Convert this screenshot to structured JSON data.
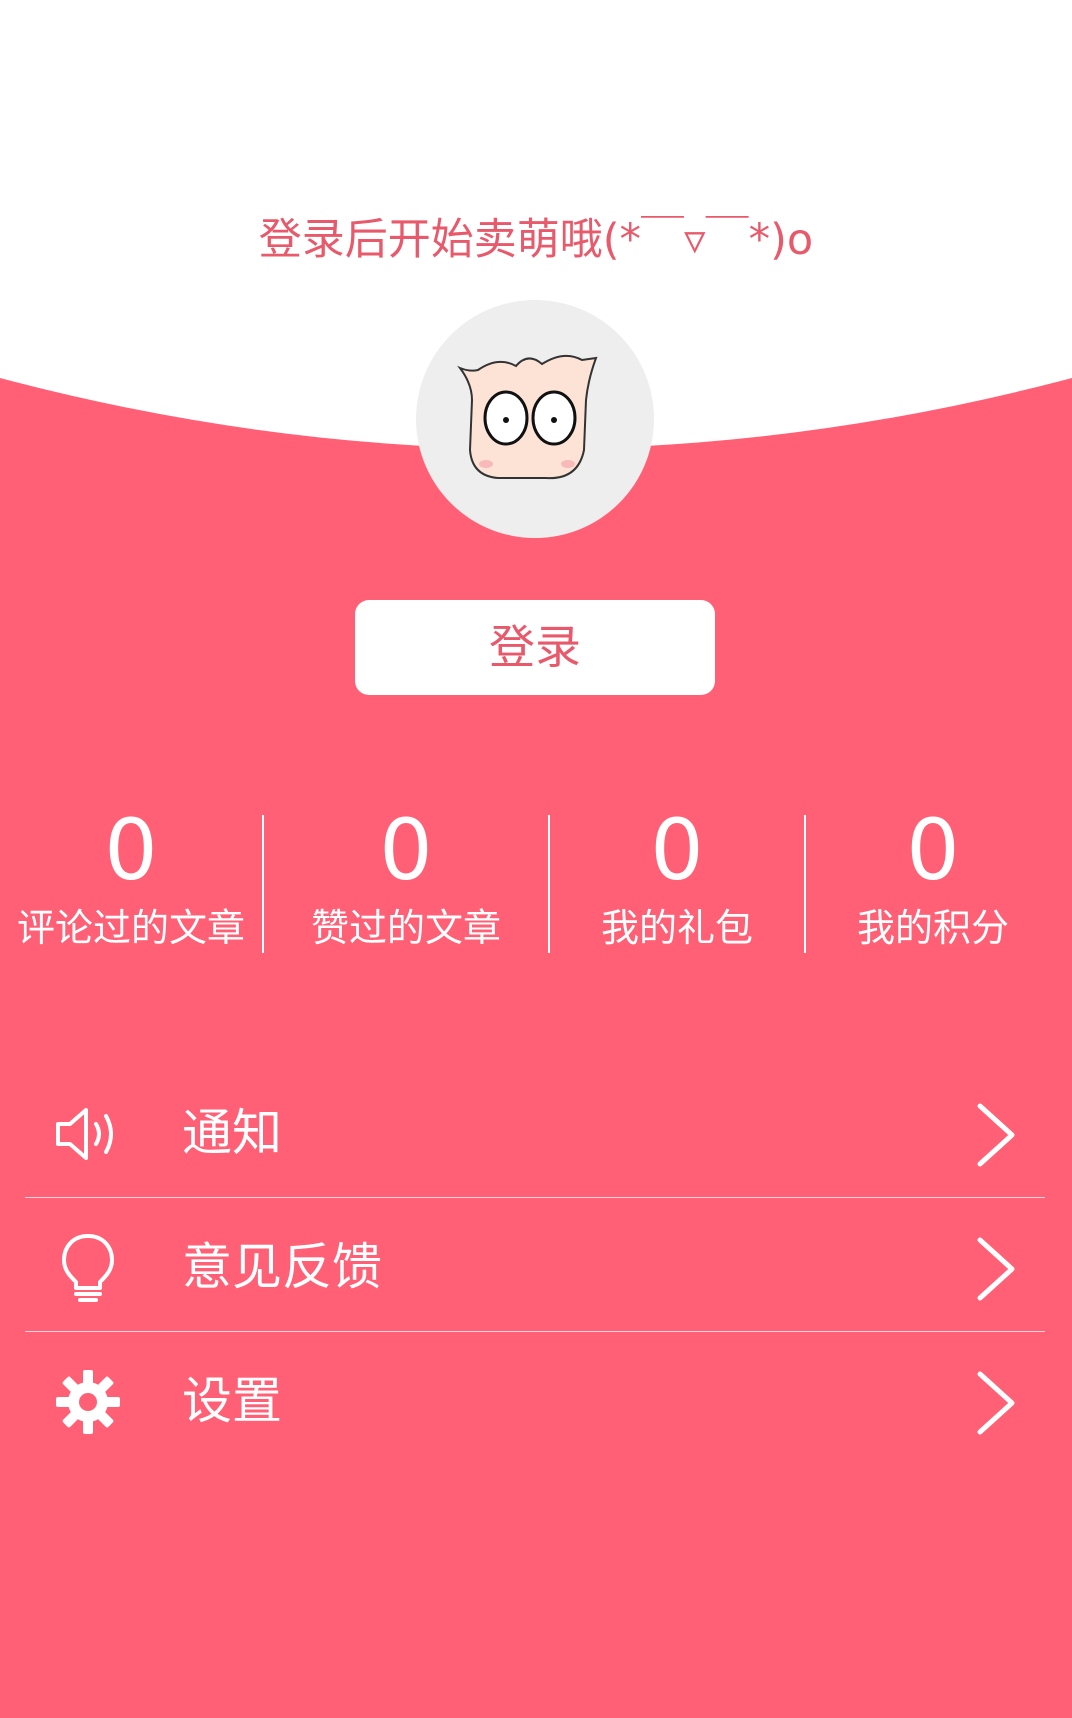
{
  "header": {
    "tagline": "登录后开始卖萌哦(*￣▿￣*)o"
  },
  "avatar": {
    "icon": "cartoon-avatar"
  },
  "login_button": {
    "label": "登录"
  },
  "stats": [
    {
      "value": "0",
      "label": "评论过的文章"
    },
    {
      "value": "0",
      "label": "赞过的文章"
    },
    {
      "value": "0",
      "label": "我的礼包"
    },
    {
      "value": "0",
      "label": "我的积分"
    }
  ],
  "menu": [
    {
      "label": "通知",
      "icon": "speaker-icon"
    },
    {
      "label": "意见反馈",
      "icon": "lightbulb-icon"
    },
    {
      "label": "设置",
      "icon": "gear-icon"
    }
  ],
  "colors": {
    "accent": "#ff6075",
    "text_accent": "#e85a6b",
    "avatar_bg": "#eeeeee"
  }
}
